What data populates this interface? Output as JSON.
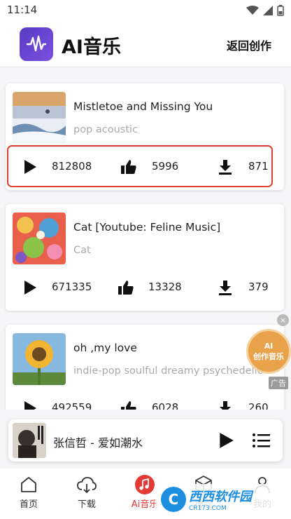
{
  "status": {
    "time": "11:14"
  },
  "header": {
    "title": "AI音乐",
    "back_label": "返回创作"
  },
  "songs": [
    {
      "title": "Mistletoe and Missing You",
      "tags": "pop acoustic",
      "plays": "812808",
      "likes": "5996",
      "downloads": "871"
    },
    {
      "title": "Cat [Youtube: Feline Music]",
      "tags": "Cat",
      "plays": "671335",
      "likes": "13328",
      "downloads": "379"
    },
    {
      "title": "oh ,my love",
      "tags": "indie-pop soulful  dreamy psychedelic",
      "plays": "492559",
      "likes": "6028",
      "downloads": "260"
    }
  ],
  "ad": {
    "line1": "AI",
    "line2": "创作音乐",
    "close": "×",
    "label": "广告"
  },
  "player": {
    "now_playing": "张信哲 - 爱如潮水"
  },
  "tabs": [
    {
      "label": "首页",
      "icon": "home-icon"
    },
    {
      "label": "下载",
      "icon": "cloud-download-icon"
    },
    {
      "label": "Ai音乐",
      "icon": "music-note-icon"
    },
    {
      "label": "推荐",
      "icon": "cube-icon"
    },
    {
      "label": "我的",
      "icon": "user-icon"
    }
  ],
  "watermark": {
    "main": "西西软件园",
    "sub": "CR173.COM"
  },
  "colors": {
    "accent": "#e53935",
    "highlight_border": "#d9432f",
    "logo": "#5b3bc4"
  }
}
